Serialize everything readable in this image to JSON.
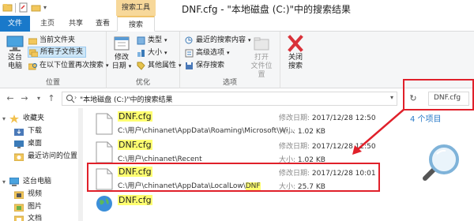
{
  "colors": {
    "accent": "#1979ca",
    "highlight": "#ffff70",
    "annotation_red": "#e0202a",
    "context_tab": "#f7d89a"
  },
  "window": {
    "title": "DNF.cfg - \"本地磁盘 (C:)\"中的搜索结果",
    "context_tab_header": "搜索工具"
  },
  "tabs": {
    "file": "文件",
    "home": "主页",
    "share": "共享",
    "view": "查看",
    "search": "搜索"
  },
  "ribbon": {
    "location": {
      "this_pc_line1": "这台",
      "this_pc_line2": "电脑",
      "current_folder": "当前文件夹",
      "all_subfolders": "所有子文件夹",
      "search_again": "在以下位置再次搜索",
      "group_label": "位置"
    },
    "refine": {
      "date_modified_line1": "修改",
      "date_modified_line2": "日期",
      "kind": "类型",
      "size": "大小",
      "other_props": "其他属性",
      "group_label": "优化"
    },
    "options": {
      "recent_searches": "最近的搜索内容",
      "advanced": "高级选项",
      "save_search": "保存搜索",
      "open_location_line1": "打开",
      "open_location_line2": "文件位置",
      "group_label": "选项"
    },
    "close": {
      "label_line1": "关闭",
      "label_line2": "搜索"
    }
  },
  "address": {
    "path": "\"本地磁盘 (C:)\"中的搜索结果",
    "search_value": "DNF.cfg"
  },
  "nav": {
    "items": [
      {
        "label": "收藏夹",
        "icon": "star-icon"
      },
      {
        "label": "下载",
        "icon": "download-folder-icon"
      },
      {
        "label": "桌面",
        "icon": "desktop-icon"
      },
      {
        "label": "最近访问的位置",
        "icon": "recent-places-icon"
      },
      {
        "label": "这台电脑",
        "icon": "computer-icon"
      },
      {
        "label": "视频",
        "icon": "video-folder-icon"
      },
      {
        "label": "图片",
        "icon": "picture-folder-icon"
      },
      {
        "label": "文档",
        "icon": "document-folder-icon"
      }
    ]
  },
  "results": {
    "count_text": "4 个项目",
    "date_label": "修改日期:",
    "size_label": "大小:",
    "items": [
      {
        "name": "DNF.cfg",
        "path": "C:\\用户\\chinanet\\AppData\\Roaming\\Microsoft\\Wi...",
        "date": "2017/12/28 12:50",
        "size": "1.02 KB"
      },
      {
        "name": "DNF.cfg",
        "path": "C:\\用户\\chinanet\\Recent",
        "date": "2017/12/28 12:50",
        "size": "1.02 KB"
      },
      {
        "name": "DNF.cfg",
        "path_prefix": "C:\\用户\\chinanet\\AppData\\LocalLow\\",
        "path_highlight": "DNF",
        "date": "2017/12/28 10:01",
        "size": "25.7 KB"
      },
      {
        "name": "DNF.cfg"
      }
    ]
  }
}
